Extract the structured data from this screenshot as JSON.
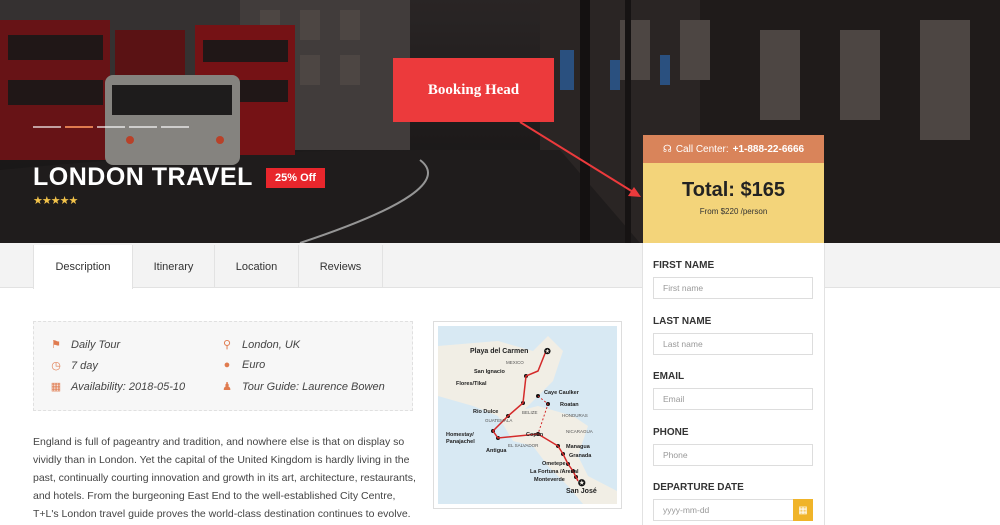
{
  "hero": {
    "title": "LONDON TRAVEL",
    "discount": "25% Off",
    "stars": "★★★★★",
    "rating": 5
  },
  "annotation": {
    "label": "Booking Head"
  },
  "tabs": [
    {
      "label": "Description",
      "active": true
    },
    {
      "label": "Itinerary",
      "active": false
    },
    {
      "label": "Location",
      "active": false
    },
    {
      "label": "Reviews",
      "active": false
    }
  ],
  "info": {
    "tour_type": "Daily Tour",
    "duration": "7 day",
    "availability": "Availability: 2018-05-10",
    "location": "London, UK",
    "currency": "Euro",
    "guide": "Tour Guide: Laurence Bowen"
  },
  "description": "England is full of pageantry and tradition, and nowhere else is that on display so vividly than in London. Yet the capital of the United Kingdom is hardly living in the past, continually courting innovation and growth in its art, architecture, restaurants, and hotels. From the burgeoning East End to the well-established City Centre, T+L's London travel guide proves the world-class destination continues to evolve.",
  "map": {
    "places": {
      "playa": "Playa del Carmen",
      "mexico": "MEXICO",
      "san_ignacio": "San Ignacio",
      "flores": "Flores/Tikal",
      "caye": "Caye Caulker",
      "roatan": "Roatan",
      "rio_dulce": "Rio Dulce",
      "belize": "BELIZE",
      "honduras": "HONDURAS",
      "guatemala": "GUATEMALA",
      "homestay": "Homestay/",
      "panajachel": "Panajachel",
      "copan": "Copán",
      "nicaragua": "NICARAGUA",
      "el_salvador": "EL SALVADOR",
      "antigua": "Antigua",
      "managua": "Managua",
      "granada": "Granada",
      "ometepe": "Ometepe",
      "la_fortuna": "La Fortuna /Arenal",
      "monteverde": "Monteverde",
      "san_jose": "San José"
    }
  },
  "booking": {
    "call_label": "Call Center:",
    "phone": "+1-888-22-6666",
    "total": "Total: $165",
    "from": "From $220 /person",
    "fields": {
      "first_name": {
        "label": "FIRST NAME",
        "placeholder": "First name"
      },
      "last_name": {
        "label": "LAST NAME",
        "placeholder": "Last name"
      },
      "email": {
        "label": "EMAIL",
        "placeholder": "Email"
      },
      "phone": {
        "label": "PHONE",
        "placeholder": "Phone"
      },
      "departure": {
        "label": "DEPARTURE DATE",
        "placeholder": "yyyy-mm-dd"
      }
    }
  },
  "colors": {
    "accent": "#e07b4f",
    "discount": "#e8262c",
    "total_bg": "#f3d47a",
    "call_bg": "#d9845a",
    "annotation": "#ec3a3c",
    "calendar_btn": "#f0b429"
  },
  "icons": [
    "flag-icon",
    "clock-icon",
    "calendar-icon",
    "map-pin-icon",
    "globe-icon",
    "user-icon",
    "headset-icon"
  ]
}
